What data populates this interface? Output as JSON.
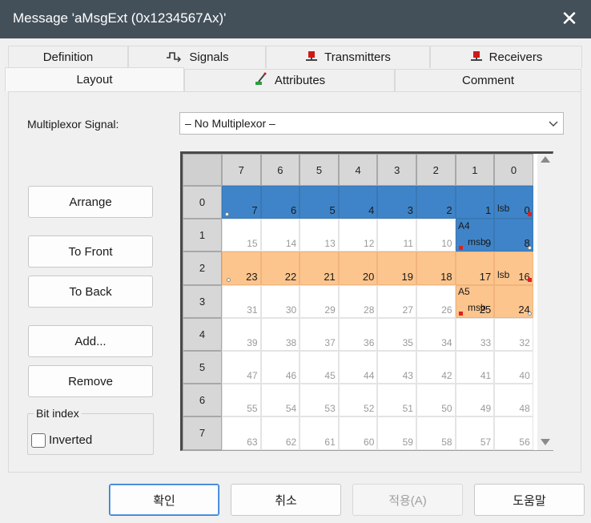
{
  "window": {
    "title": "Message 'aMsgExt (0x1234567Ax)'"
  },
  "tabs_top": [
    {
      "label": "Definition",
      "icon": ""
    },
    {
      "label": "Signals",
      "icon": "signals-icon"
    },
    {
      "label": "Transmitters",
      "icon": "transmitter-node-icon"
    },
    {
      "label": "Receivers",
      "icon": "receiver-node-icon"
    }
  ],
  "tabs_bottom": [
    {
      "label": "Layout",
      "selected": true,
      "icon": ""
    },
    {
      "label": "Attributes",
      "icon": "attributes-icon"
    },
    {
      "label": "Comment",
      "icon": ""
    }
  ],
  "multiplexor": {
    "label": "Multiplexor Signal:",
    "value": "– No Multiplexor –"
  },
  "side_buttons": {
    "arrange": "Arrange",
    "to_front": "To Front",
    "to_back": "To Back",
    "add": "Add...",
    "remove": "Remove"
  },
  "bit_index": {
    "label": "Bit index",
    "inverted_label": "Inverted",
    "inverted_checked": false
  },
  "grid": {
    "column_headers": [
      "7",
      "6",
      "5",
      "4",
      "3",
      "2",
      "1",
      "0"
    ],
    "row_headers": [
      "0",
      "1",
      "2",
      "3",
      "4",
      "5",
      "6",
      "7"
    ],
    "rows": [
      [
        "7",
        "6",
        "5",
        "4",
        "3",
        "2",
        "1",
        "0"
      ],
      [
        "15",
        "14",
        "13",
        "12",
        "11",
        "10",
        "9",
        "8"
      ],
      [
        "23",
        "22",
        "21",
        "20",
        "19",
        "18",
        "17",
        "16"
      ],
      [
        "31",
        "30",
        "29",
        "28",
        "27",
        "26",
        "25",
        "24"
      ],
      [
        "39",
        "38",
        "37",
        "36",
        "35",
        "34",
        "33",
        "32"
      ],
      [
        "47",
        "46",
        "45",
        "44",
        "43",
        "42",
        "41",
        "40"
      ],
      [
        "55",
        "54",
        "53",
        "52",
        "51",
        "50",
        "49",
        "48"
      ],
      [
        "63",
        "62",
        "61",
        "60",
        "59",
        "58",
        "57",
        "56"
      ]
    ],
    "signal_a4": {
      "name": "A4",
      "color": "#3f84c8",
      "msb": "msb",
      "lsb": "lsb"
    },
    "signal_a5": {
      "name": "A5",
      "color": "#fcc58e",
      "msb": "msb",
      "lsb": "lsb"
    }
  },
  "dialog_buttons": {
    "ok": "확인",
    "cancel": "취소",
    "apply": "적용(A)",
    "help": "도움말"
  },
  "colors": {
    "titlebar": "#43505a",
    "a4_fill": "#3f84c8",
    "a5_fill": "#fcc58e",
    "marker_red": "#e02020"
  }
}
